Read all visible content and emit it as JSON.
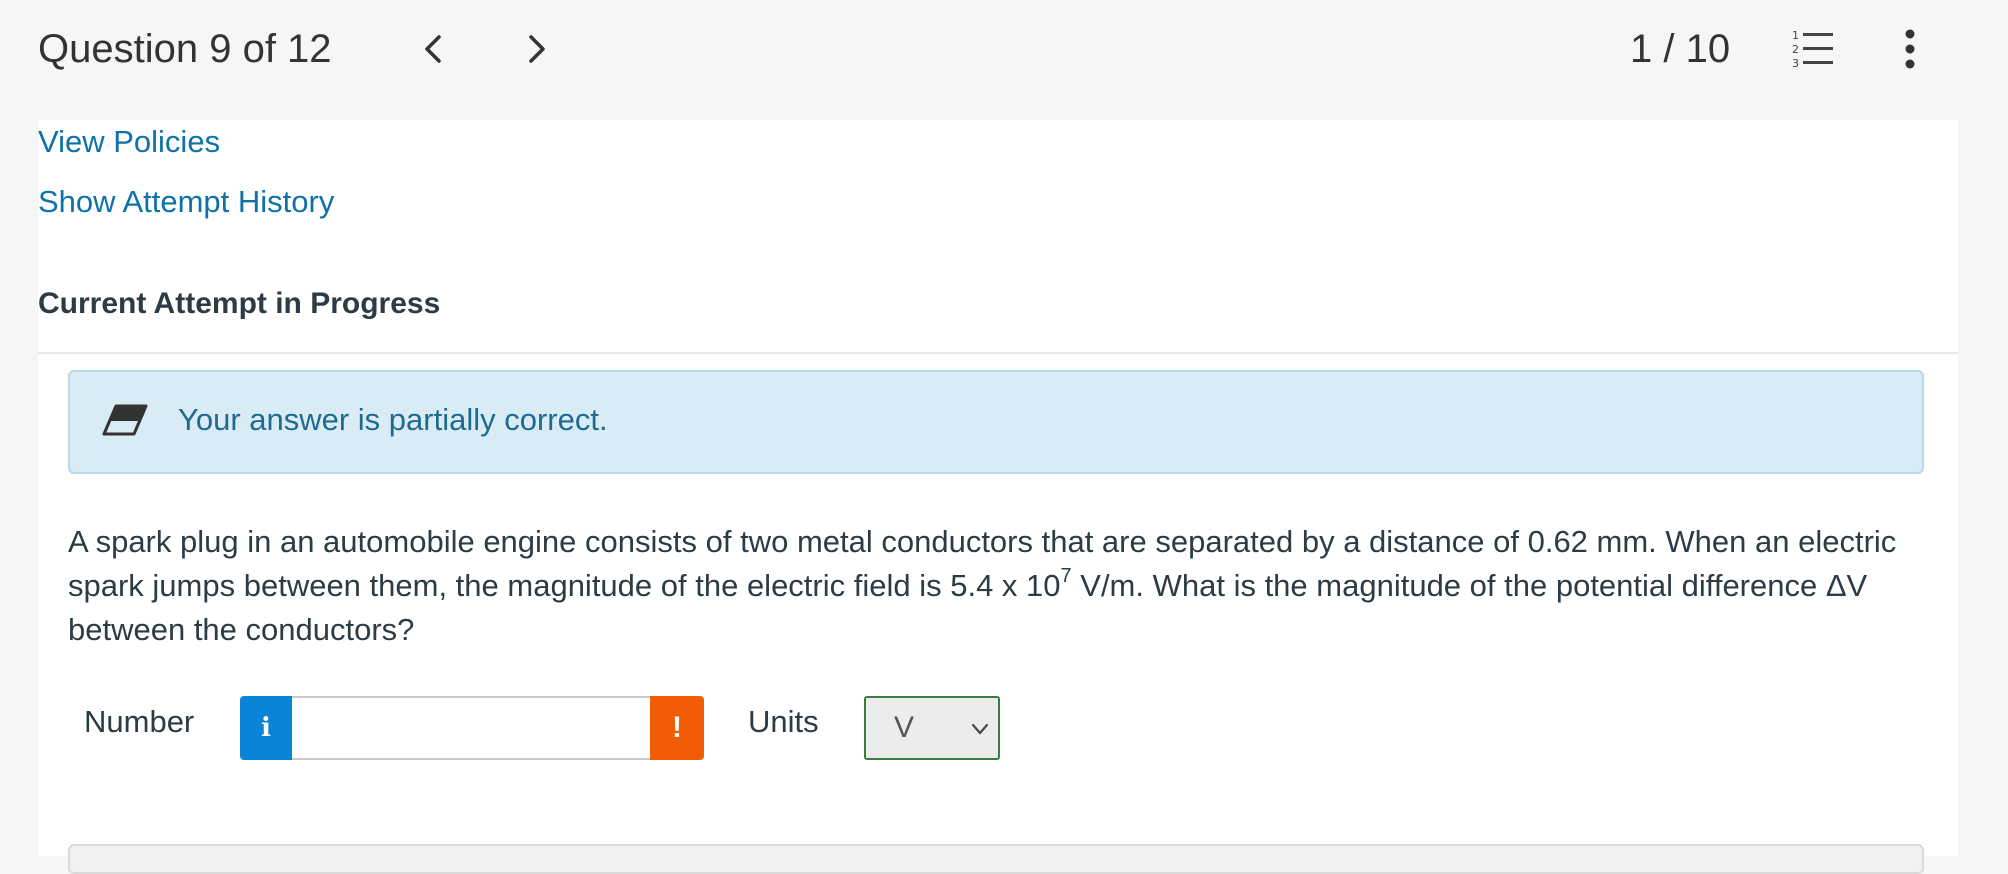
{
  "header": {
    "title": "Question 9 of 12",
    "counter": "1 / 10",
    "prev_icon": "chevron-left-icon",
    "next_icon": "chevron-right-icon",
    "list_icon": "numbered-list-icon",
    "menu_icon": "kebab-menu-icon"
  },
  "links": {
    "view_policies": "View Policies",
    "show_attempt_history": "Show Attempt History"
  },
  "attempt": {
    "heading": "Current Attempt in Progress"
  },
  "feedback": {
    "icon": "eraser-icon",
    "text": "Your answer is partially correct."
  },
  "question": {
    "text_part1": "A spark plug in an automobile engine consists of two metal conductors that are separated by a distance of 0.62 mm. When an electric spark jumps between them, the magnitude of the electric field is 5.4 x 10",
    "exponent": "7",
    "text_part2": " V/m. What is the magnitude of the potential difference ΔV between the conductors?"
  },
  "answer": {
    "number_label": "Number",
    "number_value": "",
    "info_icon": "i",
    "warn_icon": "!",
    "units_label": "Units",
    "units_value": "V"
  },
  "colors": {
    "link": "#0e72a8",
    "feedback_bg": "#d9ecf5",
    "info_button": "#0a84d6",
    "warn_button": "#f25c05",
    "select_border": "#3c7d3c"
  }
}
